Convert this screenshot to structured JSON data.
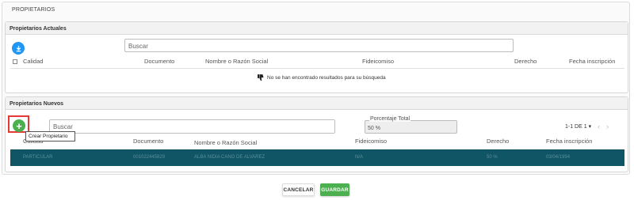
{
  "page_title": "PROPIETARIOS",
  "actuales": {
    "title": "Propietarios Actuales",
    "search_placeholder": "Buscar",
    "download_icon": "download-icon",
    "columns": [
      "Calidad",
      "Documento",
      "Nombre o Razón Social",
      "Fideicomiso",
      "Derecho",
      "Fecha inscripción"
    ],
    "empty_message": "No se han encontrado resultados para su búsqueda",
    "empty_icon": "thumb-down-icon"
  },
  "nuevos": {
    "title": "Propietarios Nuevos",
    "add_icon": "plus-icon",
    "search_placeholder": "Buscar",
    "tooltip": "Crear Propietario",
    "percentage_label": "Porcentaje Total",
    "percentage_value": "50 %",
    "pagination": "1-1 DE 1",
    "columns": [
      "Calidad",
      "Documento",
      "Nombre o Razón Social",
      "Fideicomiso",
      "Derecho",
      "Fecha inscripción"
    ],
    "row": {
      "calidad": "PARTICULAR",
      "documento": "001022445829",
      "nombre": "ALBA NIDIA CANO DE ALVAREZ",
      "fideicomiso": "N/A",
      "derecho": "50 %",
      "fecha": "03/04/1994"
    },
    "row_color": "#0f5566"
  },
  "actions": {
    "cancel_label": "CANCELAR",
    "save_label": "GUARDAR",
    "save_color": "#4caf50"
  }
}
